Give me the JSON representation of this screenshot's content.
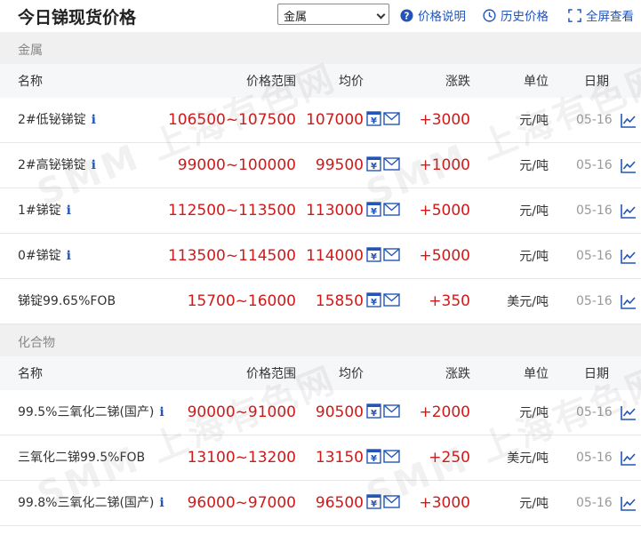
{
  "header": {
    "title": "今日锑现货价格",
    "select_value": "金属",
    "links": {
      "price_info": "价格说明",
      "history": "历史价格",
      "fullscreen": "全屏查看"
    }
  },
  "columns": {
    "name": "名称",
    "range": "价格范围",
    "avg": "均价",
    "change": "涨跌",
    "unit": "单位",
    "date": "日期"
  },
  "sections": [
    {
      "label": "金属",
      "rows": [
        {
          "name": "2#低铋锑锭",
          "info": true,
          "range": "106500~107500",
          "avg": "107000",
          "change": "+3000",
          "unit": "元/吨",
          "date": "05-16"
        },
        {
          "name": "2#高铋锑锭",
          "info": true,
          "range": "99000~100000",
          "avg": "99500",
          "change": "+1000",
          "unit": "元/吨",
          "date": "05-16"
        },
        {
          "name": "1#锑锭",
          "info": true,
          "range": "112500~113500",
          "avg": "113000",
          "change": "+5000",
          "unit": "元/吨",
          "date": "05-16"
        },
        {
          "name": "0#锑锭",
          "info": true,
          "range": "113500~114500",
          "avg": "114000",
          "change": "+5000",
          "unit": "元/吨",
          "date": "05-16"
        },
        {
          "name": "锑锭99.65%FOB",
          "info": false,
          "range": "15700~16000",
          "avg": "15850",
          "change": "+350",
          "unit": "美元/吨",
          "date": "05-16"
        }
      ]
    },
    {
      "label": "化合物",
      "rows": [
        {
          "name": "99.5%三氧化二锑(国产)",
          "info": true,
          "range": "90000~91000",
          "avg": "90500",
          "change": "+2000",
          "unit": "元/吨",
          "date": "05-16"
        },
        {
          "name": "三氧化二锑99.5%FOB",
          "info": false,
          "range": "13100~13200",
          "avg": "13150",
          "change": "+250",
          "unit": "美元/吨",
          "date": "05-16"
        },
        {
          "name": "99.8%三氧化二锑(国产)",
          "info": true,
          "range": "96000~97000",
          "avg": "96500",
          "change": "+3000",
          "unit": "元/吨",
          "date": "05-16"
        }
      ]
    }
  ],
  "info_glyph": "i",
  "watermark": "SMM 上海有色网",
  "colors": {
    "accent": "#2355b8",
    "price": "#d01919",
    "section_bg": "#f0f0f0",
    "header_bg": "#f6f7f9"
  },
  "icons": [
    "question-circle-icon",
    "clock-icon",
    "fullscreen-icon",
    "yuan-calc-icon",
    "mail-icon",
    "trend-chart-icon",
    "select-caret-icon"
  ]
}
